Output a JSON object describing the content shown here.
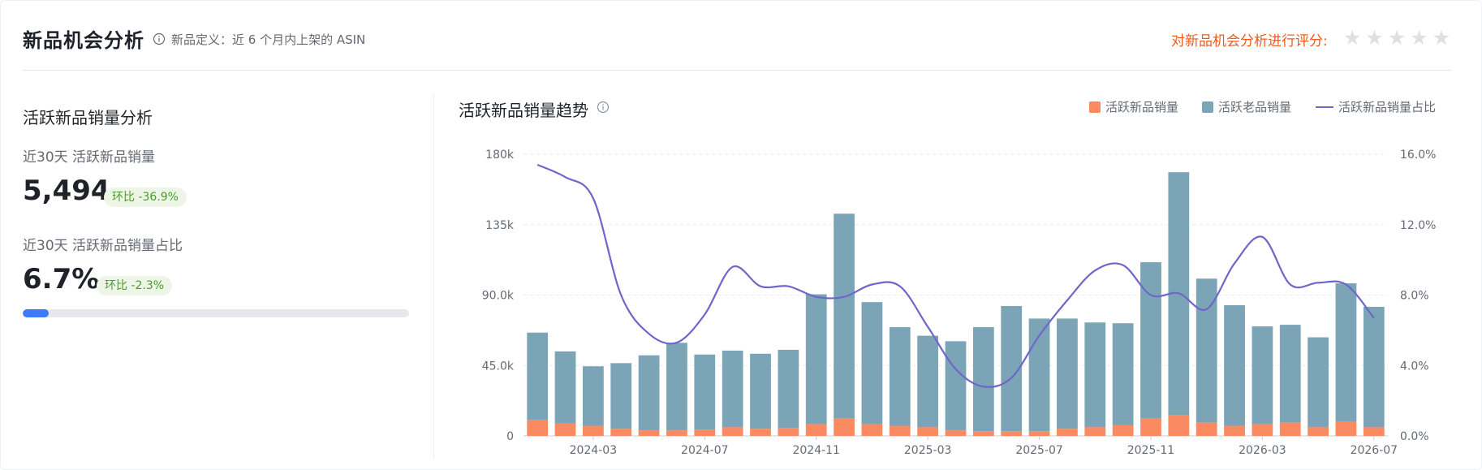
{
  "header": {
    "title": "新品机会分析",
    "definition": "新品定义：近 6 个月内上架的 ASIN",
    "rating_label": "对新品机会分析进行评分:",
    "stars_total": 5,
    "stars_filled": 0
  },
  "left": {
    "title": "活跃新品销量分析",
    "sales": {
      "label": "近30天 活跃新品销量",
      "value": "5,494",
      "change": "环比 -36.9%"
    },
    "share": {
      "label": "近30天 活跃新品销量占比",
      "value": "6.7%",
      "change": "环比 -2.3%",
      "progress": 0.067
    }
  },
  "chart": {
    "title": "活跃新品销量趋势",
    "legend": {
      "new_sales": "活跃新品销量",
      "old_sales": "活跃老品销量",
      "ratio": "活跃新品销量占比"
    }
  },
  "colors": {
    "new_sales": "#f98a61",
    "old_sales": "#7ba5b6",
    "ratio": "#6e66c8",
    "accent": "#f05a1b",
    "progress": "#3b7cf5"
  },
  "chart_data": {
    "type": "bar",
    "stacked": true,
    "categories": [
      "2024-01",
      "2024-02",
      "2024-03",
      "2024-04",
      "2024-05",
      "2024-06",
      "2024-07",
      "2024-08",
      "2024-09",
      "2024-10",
      "2024-11",
      "2024-12",
      "2025-01",
      "2025-02",
      "2025-03",
      "2025-04",
      "2025-05",
      "2025-06",
      "2025-07",
      "2025-08",
      "2025-09",
      "2025-10",
      "2025-11",
      "2025-12",
      "2026-01",
      "2026-02",
      "2026-03",
      "2026-04",
      "2026-05",
      "2026-06",
      "2026-07"
    ],
    "x_tick_labels": [
      "2024-03",
      "2024-07",
      "2024-11",
      "2025-03",
      "2025-07",
      "2025-11",
      "2026-03",
      "2026-07"
    ],
    "series": [
      {
        "name": "活跃新品销量",
        "axis": "left",
        "values": [
          10000,
          8000,
          6500,
          4500,
          3500,
          3500,
          4000,
          5500,
          4500,
          5000,
          7500,
          11000,
          7500,
          6500,
          5500,
          3500,
          3000,
          3000,
          3000,
          4500,
          5500,
          7000,
          11000,
          13500,
          8500,
          6500,
          7500,
          8500,
          5500,
          9000,
          5494
        ]
      },
      {
        "name": "活跃老品销量",
        "axis": "left",
        "values": [
          56000,
          46000,
          38000,
          42000,
          48000,
          56000,
          48000,
          49000,
          48000,
          50000,
          83000,
          131000,
          78000,
          63000,
          58500,
          57000,
          66500,
          80000,
          72000,
          70500,
          67000,
          65000,
          100000,
          155000,
          92000,
          77000,
          62500,
          62500,
          57500,
          88500,
          77000
        ]
      },
      {
        "name": "活跃新品销量占比",
        "axis": "right",
        "type": "line",
        "values": [
          15.4,
          14.7,
          13.5,
          8.0,
          5.8,
          5.3,
          6.9,
          9.6,
          8.5,
          8.5,
          7.9,
          7.9,
          8.6,
          8.5,
          6.2,
          3.8,
          2.8,
          3.3,
          5.7,
          7.7,
          9.4,
          9.7,
          8.0,
          8.1,
          7.2,
          9.8,
          11.3,
          8.6,
          8.7,
          8.6,
          6.7
        ]
      }
    ],
    "y_left": {
      "ticks": [
        "0",
        "45.0k",
        "90.0k",
        "135k",
        "180k"
      ],
      "range": [
        0,
        180000
      ]
    },
    "y_right": {
      "ticks": [
        "0.0%",
        "4.0%",
        "8.0%",
        "12.0%",
        "16.0%"
      ],
      "range": [
        0,
        16
      ]
    },
    "grid": true,
    "legend_position": "top-right"
  }
}
